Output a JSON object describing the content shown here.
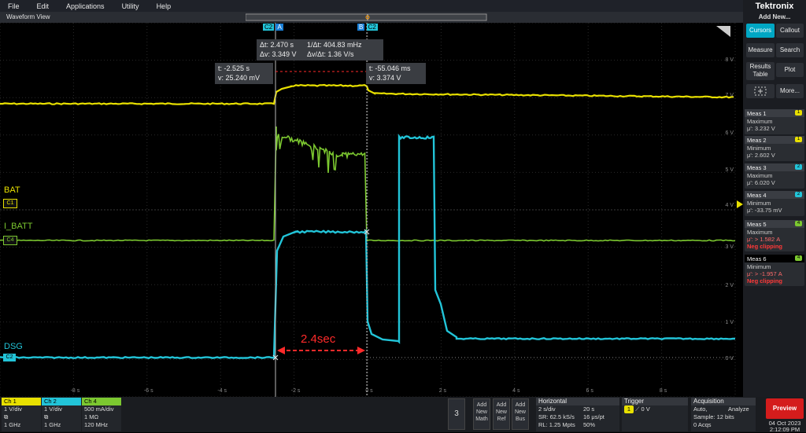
{
  "menu": [
    "File",
    "Edit",
    "Applications",
    "Utility",
    "Help"
  ],
  "window_title": "Waveform View",
  "brand": "Tektronix",
  "add_new": "Add New...",
  "side_buttons": {
    "cursors": "Cursors",
    "callout": "Callout",
    "measure": "Measure",
    "search": "Search",
    "results_table_1": "Results",
    "results_table_2": "Table",
    "plot": "Plot",
    "more": "More..."
  },
  "measurements": [
    {
      "name": "Meas 1",
      "badge": "1",
      "badge_color": "#e8e000",
      "type": "Maximum",
      "value": "μ': 3.232 V",
      "warn": ""
    },
    {
      "name": "Meas 2",
      "badge": "1",
      "badge_color": "#e8e000",
      "type": "Minimum",
      "value": "μ': 2.602 V",
      "warn": ""
    },
    {
      "name": "Meas 3",
      "badge": "2",
      "badge_color": "#22c4d8",
      "type": "Maximum",
      "value": "μ': 6.020 V",
      "warn": ""
    },
    {
      "name": "Meas 4",
      "badge": "2",
      "badge_color": "#22c4d8",
      "type": "Minimum",
      "value": "μ': -33.75 mV",
      "warn": ""
    },
    {
      "name": "Meas 5",
      "badge": "4",
      "badge_color": "#7cc830",
      "type": "Maximum",
      "value": "μ': > 1.582 A",
      "warn": "Neg clipping"
    },
    {
      "name": "Meas 6",
      "badge": "4",
      "badge_color": "#7cc830",
      "type": "Minimum",
      "value": "μ': > -1.957 A",
      "warn": "Neg clipping"
    }
  ],
  "channel_labels": {
    "bat": "BAT",
    "ibatt": "I_BATT",
    "dsg": "DSG",
    "c1": "C1",
    "c4": "C4",
    "c2": "C2"
  },
  "cursor_flags": {
    "a_ch": "C2",
    "a": "A",
    "b": "B",
    "b_ch": "C2"
  },
  "cursor_delta": {
    "dt": "Δt: 2.470 s",
    "inv_dt": "1/Δt: 404.83 mHz",
    "dv": "Δv: 3.349 V",
    "dvdt": "Δv/Δt: 1.36 V/s"
  },
  "cursor_a": {
    "t": "t: -2.525 s",
    "v": "v: 25.240 mV"
  },
  "cursor_b": {
    "t": "t: -55.046 ms",
    "v": "v: 3.374 V"
  },
  "annotation": "2.4sec",
  "x_ticks": [
    "-8 s",
    "-6 s",
    "-4 s",
    "-2 s",
    "0 s",
    "2 s",
    "4 s",
    "6 s",
    "8 s"
  ],
  "y_ticks": [
    "8 V",
    "7 V",
    "6 V",
    "5 V",
    "4 V",
    "3 V",
    "2 V",
    "1 V",
    "0 V"
  ],
  "channels": [
    {
      "name": "Ch 1",
      "color": "#e8e000",
      "l1": "1 V/div",
      "l2": "⧉",
      "l3": "1 GHz"
    },
    {
      "name": "Ch 2",
      "color": "#22c4d8",
      "l1": "1 V/div",
      "l2": "⧉",
      "l3": "1 GHz"
    },
    {
      "name": "Ch 4",
      "color": "#7cc830",
      "l1": "500 mA/div",
      "l2": "1 MΩ",
      "l3": "120 MHz"
    }
  ],
  "page_number": "3",
  "add_buttons": [
    [
      "Add",
      "New",
      "Math"
    ],
    [
      "Add",
      "New",
      "Ref"
    ],
    [
      "Add",
      "New",
      "Bus"
    ]
  ],
  "horizontal": {
    "title": "Horizontal",
    "r1a": "2 s/div",
    "r1b": "20 s",
    "r2a": "SR: 62.5 kS/s",
    "r2b": "16 μs/pt",
    "r3a": "RL: 1.25 Mpts",
    "r3b": "50%"
  },
  "trigger": {
    "title": "Trigger",
    "ch": "1",
    "level": "0 V"
  },
  "acquisition": {
    "title": "Acquisition",
    "mode": "Auto,",
    "analyze": "Analyze",
    "sample": "Sample: 12 bits",
    "acqs": "0 Acqs"
  },
  "preview": "Preview",
  "date": "04 Oct 2023",
  "time": "2:12:09 PM",
  "colors": {
    "ch1": "#e8e000",
    "ch2": "#22c4d8",
    "ch4": "#7cc830",
    "accent": "#00a7c4"
  },
  "chart_data": {
    "type": "line",
    "x_unit": "s",
    "x_range": [
      -10,
      10
    ],
    "series": [
      {
        "name": "BAT",
        "points": [
          [
            -10,
            2.6
          ],
          [
            -2.525,
            2.6
          ],
          [
            -2.45,
            3.0
          ],
          [
            -2.0,
            3.15
          ],
          [
            -0.055,
            3.2
          ],
          [
            0.1,
            3.05
          ],
          [
            2,
            2.95
          ],
          [
            10,
            2.85
          ]
        ]
      },
      {
        "name": "I_BATT",
        "points": [
          [
            -10,
            3.15
          ],
          [
            -2.5,
            3.15
          ],
          [
            -2.45,
            6.5
          ],
          [
            -1.8,
            6.0
          ],
          [
            -0.8,
            5.4
          ],
          [
            -0.055,
            5.6
          ],
          [
            0.0,
            3.15
          ],
          [
            10,
            3.15
          ]
        ]
      },
      {
        "name": "DSG",
        "points": [
          [
            -10,
            0.0
          ],
          [
            -2.525,
            0.0
          ],
          [
            -2.45,
            3.0
          ],
          [
            -2.0,
            3.3
          ],
          [
            -0.055,
            3.374
          ],
          [
            0.0,
            1.0
          ],
          [
            0.8,
            0.5
          ],
          [
            0.8,
            6.0
          ],
          [
            1.8,
            6.0
          ],
          [
            2.0,
            1.5
          ],
          [
            2.5,
            0.5
          ],
          [
            10,
            0.5
          ]
        ]
      }
    ]
  }
}
